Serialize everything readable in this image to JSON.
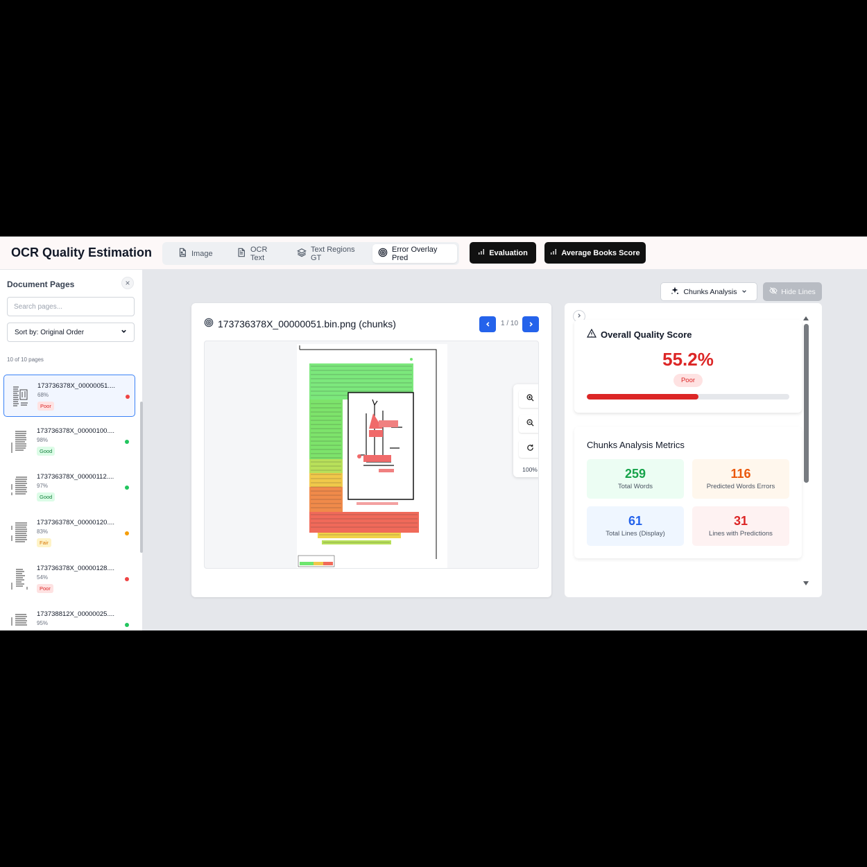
{
  "app": {
    "title": "OCR Quality Estimation"
  },
  "tabs": [
    {
      "label": "Image",
      "icon": "image-file-icon",
      "active": false
    },
    {
      "label": "OCR Text",
      "icon": "text-file-icon",
      "active": false
    },
    {
      "label": "Text Regions GT",
      "icon": "layers-icon",
      "active": false
    },
    {
      "label": "Error Overlay Pred",
      "icon": "target-icon",
      "active": true
    }
  ],
  "actions": {
    "evaluation_label": "Evaluation",
    "average_books_label": "Average Books Score"
  },
  "sidebar": {
    "title": "Document Pages",
    "search_placeholder": "Search pages...",
    "sort_label": "Sort by: Original Order",
    "count_label": "10 of 10 pages",
    "pages": [
      {
        "name": "173736378X_00000051....",
        "score": "68%",
        "badge": "Poor",
        "status_color": "#ef4444",
        "selected": true
      },
      {
        "name": "173736378X_00000100....",
        "score": "98%",
        "badge": "Good",
        "status_color": "#22c55e",
        "selected": false
      },
      {
        "name": "173736378X_00000112....",
        "score": "97%",
        "badge": "Good",
        "status_color": "#22c55e",
        "selected": false
      },
      {
        "name": "173736378X_00000120....",
        "score": "83%",
        "badge": "Fair",
        "status_color": "#f59e0b",
        "selected": false
      },
      {
        "name": "173736378X_00000128....",
        "score": "54%",
        "badge": "Poor",
        "status_color": "#ef4444",
        "selected": false
      },
      {
        "name": "173738812X_00000025....",
        "score": "95%",
        "badge": "",
        "status_color": "#22c55e",
        "selected": false
      }
    ]
  },
  "viewer": {
    "title": "173736378X_00000051.bin.png (chunks)",
    "page_indicator": "1 / 10",
    "zoom_level": "100%"
  },
  "toolbar": {
    "chunks_label": "Chunks Analysis",
    "hide_lines_label": "Hide Lines"
  },
  "quality": {
    "title": "Overall Quality Score",
    "score_text": "55.2%",
    "score_value": 55.2,
    "badge": "Poor",
    "color": "#dc2626"
  },
  "metrics": {
    "title": "Chunks Analysis Metrics",
    "items": [
      {
        "value": "259",
        "label": "Total Words",
        "color": "#16a34a",
        "bg": "#ecfdf3"
      },
      {
        "value": "116",
        "label": "Predicted Words Errors",
        "color": "#ea580c",
        "bg": "#fff7ed"
      },
      {
        "value": "61",
        "label": "Total Lines (Display)",
        "color": "#2563eb",
        "bg": "#eff6ff"
      },
      {
        "value": "31",
        "label": "Lines with Predictions",
        "color": "#dc2626",
        "bg": "#fef2f2"
      }
    ]
  },
  "colors": {
    "accent": "#2563eb",
    "poor": "#dc2626",
    "good": "#16a34a",
    "fair": "#f59e0b"
  }
}
